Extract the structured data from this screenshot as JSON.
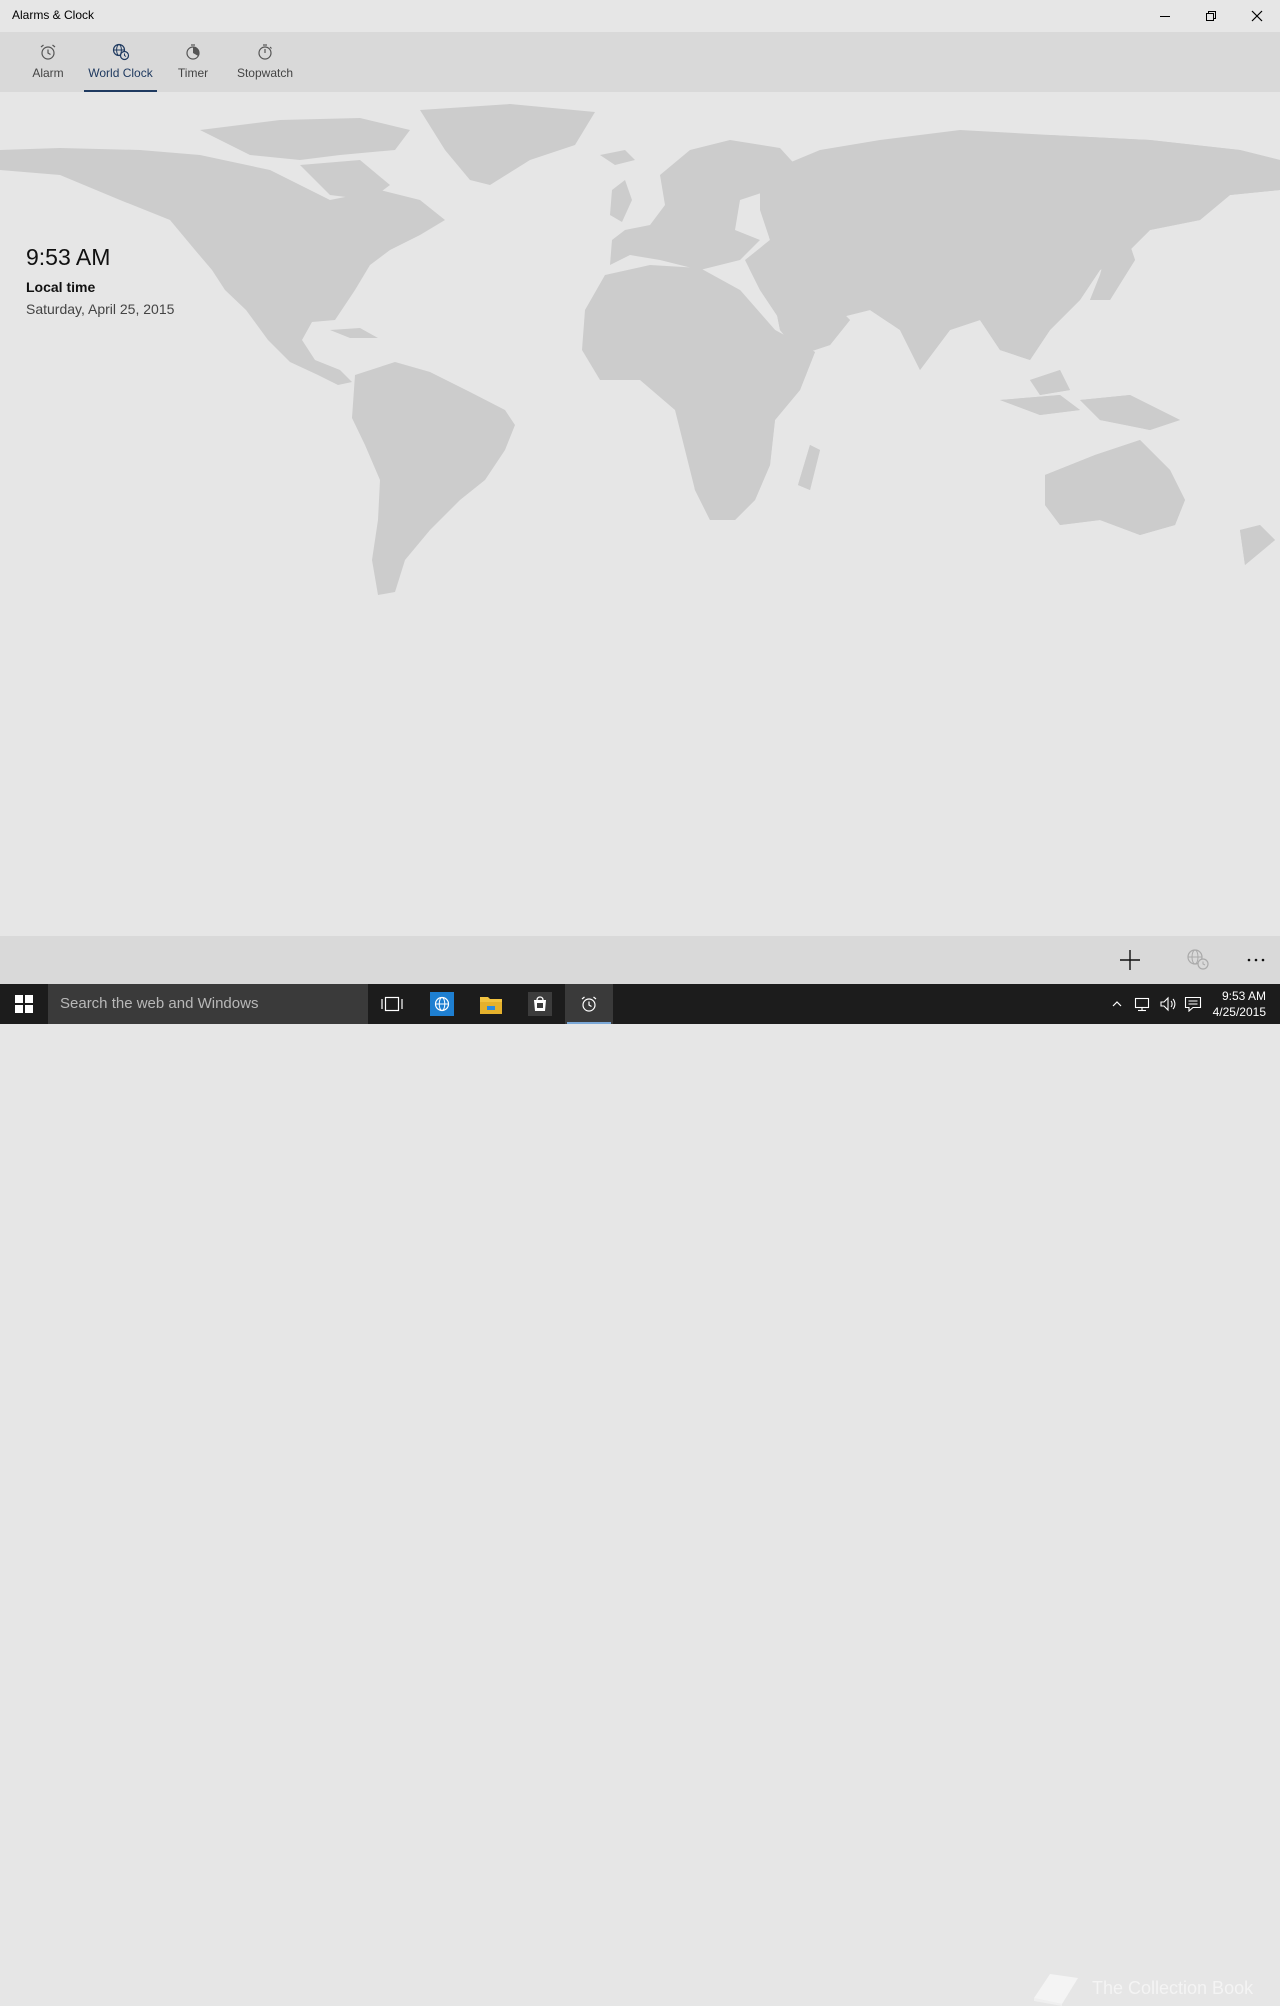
{
  "window": {
    "title": "Alarms & Clock"
  },
  "tabs": [
    {
      "label": "Alarm",
      "icon": "alarm-icon"
    },
    {
      "label": "World Clock",
      "icon": "world-clock-icon",
      "active": true
    },
    {
      "label": "Timer",
      "icon": "timer-icon"
    },
    {
      "label": "Stopwatch",
      "icon": "stopwatch-icon"
    }
  ],
  "local_clock": {
    "time": "9:53 AM",
    "label": "Local time",
    "date": "Saturday, April 25, 2015"
  },
  "command_bar": {
    "buttons": [
      "add-icon",
      "compare-clock-icon",
      "more-icon"
    ]
  },
  "taskbar": {
    "search_placeholder": "Search the web and Windows",
    "clock_time": "9:53 AM",
    "clock_date": "4/25/2015"
  },
  "watermark": {
    "text": "The Collection Book"
  },
  "colors": {
    "accent": "#1f3a60",
    "background": "#e6e6e6",
    "bars": "#d9d9d9",
    "land_day": "#cccccc",
    "land_night": "#b4b4b4",
    "taskbar": "#1c1c1c"
  }
}
